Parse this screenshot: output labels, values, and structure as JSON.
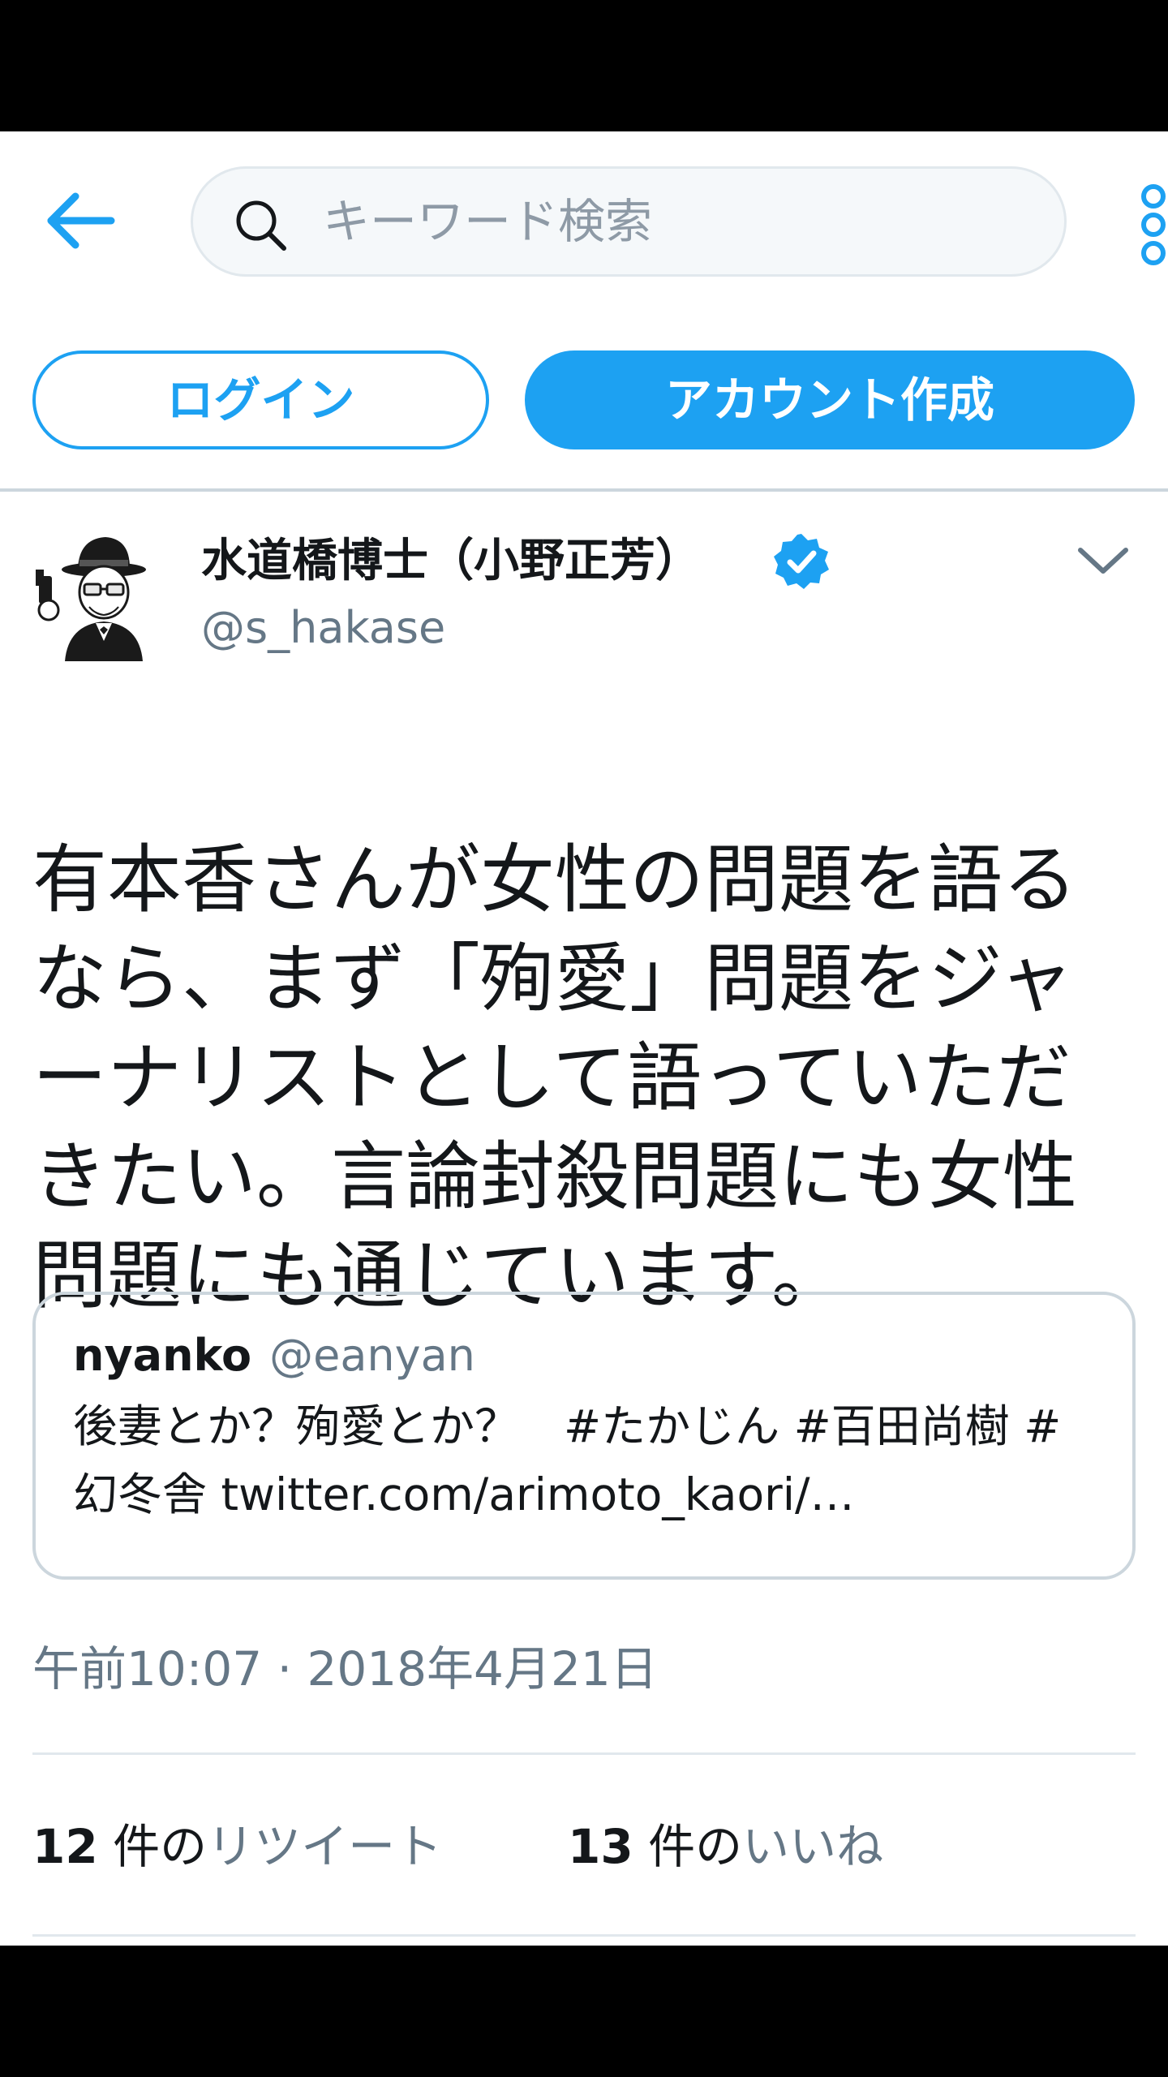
{
  "colors": {
    "brand_blue": "#1da1f2",
    "text_primary": "#14171a",
    "text_secondary": "#657786",
    "border": "#ccd6dd",
    "system_bar": "#000000"
  },
  "top_bar": {
    "back_icon": "arrow-left-icon",
    "search_placeholder": "キーワード検索",
    "search_icon": "search-icon",
    "more_icon": "vertical-dots-icon"
  },
  "auth": {
    "login_label": "ログイン",
    "signup_label": "アカウント作成"
  },
  "tweet": {
    "author": {
      "display_name": "水道橋博士（小野正芳）",
      "username": "@s_hakase",
      "verified": true,
      "avatar_icon": "avatar-caricature"
    },
    "text": "有本香さんが女性の問題を語るなら、まず「殉愛」問題をジャーナリストとして語っていただきたい。言論封殺問題にも女性問題にも通じています。",
    "quoted": {
      "display_name": "nyanko",
      "username": "@eanyan",
      "text": "後妻とか？殉愛とか？　#たかじん #百田尚樹 #幻冬舎 twitter.com/arimoto_kaori/…"
    },
    "timestamp": "午前10:07 · 2018年4月21日",
    "stats": {
      "retweets": {
        "count": "12",
        "suffix": " 件の",
        "label": "リツイート"
      },
      "likes": {
        "count": "13",
        "suffix": " 件の",
        "label": "いいね"
      }
    }
  }
}
